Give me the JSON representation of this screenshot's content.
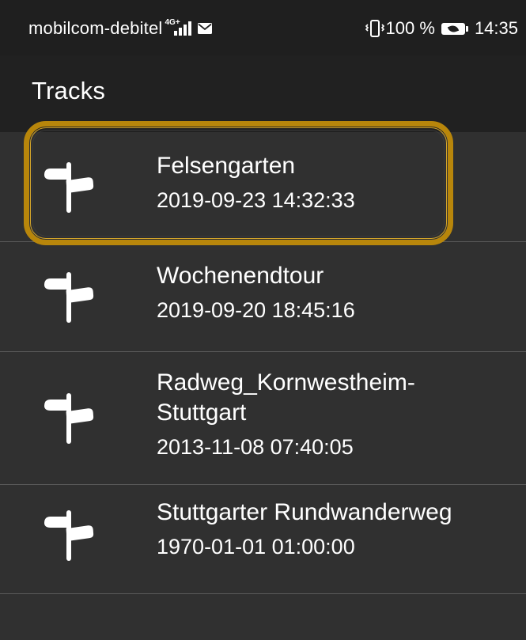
{
  "status_bar": {
    "carrier": "mobilcom-debitel",
    "network_type": "4G+",
    "signal_icon": "signal-strength-icon",
    "mail_icon": "mail-icon",
    "vibrate_icon": "vibrate-icon",
    "battery_percent": "100 %",
    "battery_icon": "battery-icon",
    "time": "14:35"
  },
  "app_bar": {
    "title": "Tracks"
  },
  "tracks": [
    {
      "name": "Felsengarten",
      "date": "2019-09-23 14:32:33",
      "icon": "signpost-icon",
      "focused": true
    },
    {
      "name": "Wochenendtour",
      "date": "2019-09-20 18:45:16",
      "icon": "signpost-icon",
      "focused": false
    },
    {
      "name": "Radweg_Kornwestheim-\nStuttgart",
      "date": "2013-11-08 07:40:05",
      "icon": "signpost-icon",
      "focused": false
    },
    {
      "name": "Stuttgarter Rundwanderweg",
      "date": "1970-01-01 01:00:00",
      "icon": "signpost-icon",
      "focused": false
    }
  ],
  "colors": {
    "background": "#303030",
    "app_bar": "#212121",
    "status_bar": "#1f1f1f",
    "focus_ring": "#b8860b",
    "divider": "#5a5a5a"
  }
}
